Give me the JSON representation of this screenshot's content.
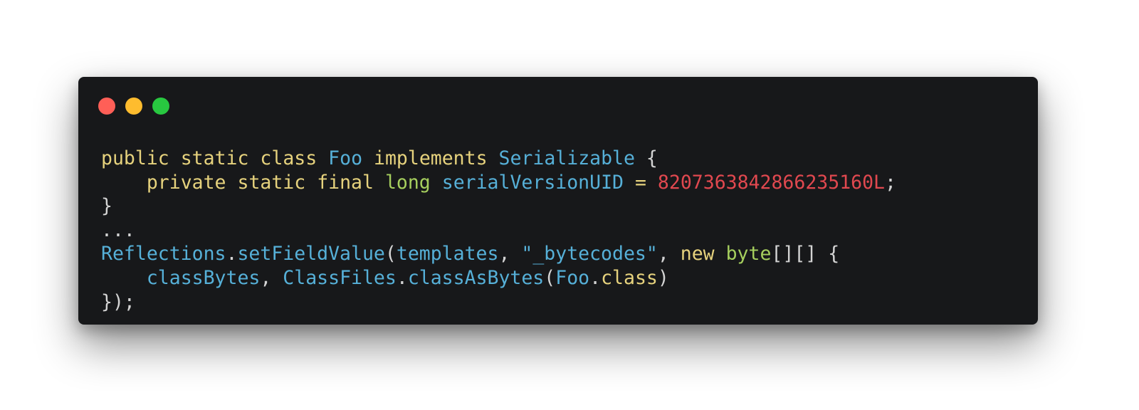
{
  "window": {
    "controls": [
      {
        "name": "close-button",
        "color": "#ff5f57"
      },
      {
        "name": "minimize-button",
        "color": "#febc2e"
      },
      {
        "name": "maximize-button",
        "color": "#28c840"
      }
    ]
  },
  "colors": {
    "keyword": "#e6d27d",
    "type_name": "#56b0d8",
    "primitive": "#a6cf5e",
    "number": "#e0484f",
    "string": "#56b0d8",
    "plain": "#d4d4d4"
  },
  "code": {
    "lines": [
      [
        {
          "text": "public",
          "kind": "keyword"
        },
        {
          "text": " ",
          "kind": "plain"
        },
        {
          "text": "static",
          "kind": "keyword"
        },
        {
          "text": " ",
          "kind": "plain"
        },
        {
          "text": "class",
          "kind": "keyword"
        },
        {
          "text": " ",
          "kind": "plain"
        },
        {
          "text": "Foo",
          "kind": "type_name"
        },
        {
          "text": " ",
          "kind": "plain"
        },
        {
          "text": "implements",
          "kind": "keyword"
        },
        {
          "text": " ",
          "kind": "plain"
        },
        {
          "text": "Serializable",
          "kind": "type_name"
        },
        {
          "text": " {",
          "kind": "plain"
        }
      ],
      [
        {
          "text": "    ",
          "kind": "plain"
        },
        {
          "text": "private",
          "kind": "keyword"
        },
        {
          "text": " ",
          "kind": "plain"
        },
        {
          "text": "static",
          "kind": "keyword"
        },
        {
          "text": " ",
          "kind": "plain"
        },
        {
          "text": "final",
          "kind": "keyword"
        },
        {
          "text": " ",
          "kind": "plain"
        },
        {
          "text": "long",
          "kind": "primitive"
        },
        {
          "text": " ",
          "kind": "plain"
        },
        {
          "text": "serialVersionUID",
          "kind": "type_name"
        },
        {
          "text": " ",
          "kind": "plain"
        },
        {
          "text": "=",
          "kind": "keyword"
        },
        {
          "text": " ",
          "kind": "plain"
        },
        {
          "text": "8207363842866235160L",
          "kind": "number"
        },
        {
          "text": ";",
          "kind": "plain"
        }
      ],
      [
        {
          "text": "}",
          "kind": "plain"
        }
      ],
      [
        {
          "text": "...",
          "kind": "plain"
        }
      ],
      [
        {
          "text": "Reflections",
          "kind": "type_name"
        },
        {
          "text": ".",
          "kind": "plain"
        },
        {
          "text": "setFieldValue",
          "kind": "type_name"
        },
        {
          "text": "(",
          "kind": "plain"
        },
        {
          "text": "templates",
          "kind": "type_name"
        },
        {
          "text": ", ",
          "kind": "plain"
        },
        {
          "text": "\"_bytecodes\"",
          "kind": "string"
        },
        {
          "text": ", ",
          "kind": "plain"
        },
        {
          "text": "new",
          "kind": "keyword"
        },
        {
          "text": " ",
          "kind": "plain"
        },
        {
          "text": "byte",
          "kind": "primitive"
        },
        {
          "text": "[][] {",
          "kind": "plain"
        }
      ],
      [
        {
          "text": "    ",
          "kind": "plain"
        },
        {
          "text": "classBytes",
          "kind": "type_name"
        },
        {
          "text": ", ",
          "kind": "plain"
        },
        {
          "text": "ClassFiles",
          "kind": "type_name"
        },
        {
          "text": ".",
          "kind": "plain"
        },
        {
          "text": "classAsBytes",
          "kind": "type_name"
        },
        {
          "text": "(",
          "kind": "plain"
        },
        {
          "text": "Foo",
          "kind": "type_name"
        },
        {
          "text": ".",
          "kind": "plain"
        },
        {
          "text": "class",
          "kind": "keyword"
        },
        {
          "text": ")",
          "kind": "plain"
        }
      ],
      [
        {
          "text": "});",
          "kind": "plain"
        }
      ]
    ]
  }
}
